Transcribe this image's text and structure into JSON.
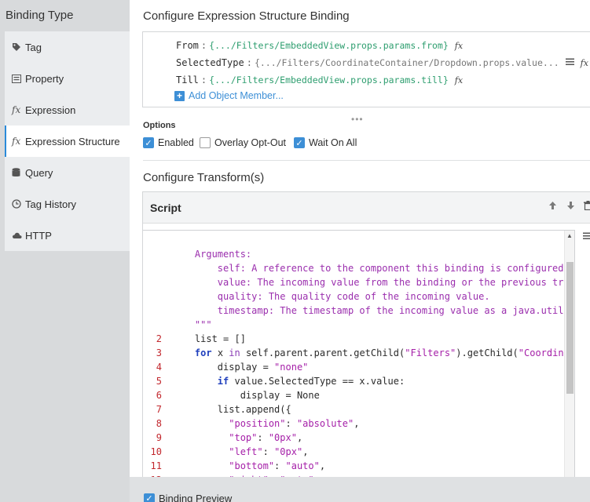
{
  "sidebar": {
    "title": "Binding Type",
    "items": [
      {
        "label": "Tag",
        "icon": "tag-icon"
      },
      {
        "label": "Property",
        "icon": "property-icon"
      },
      {
        "label": "Expression",
        "icon": "fx-icon"
      },
      {
        "label": "Expression Structure",
        "icon": "fx-icon",
        "active": true
      },
      {
        "label": "Query",
        "icon": "database-icon"
      },
      {
        "label": "Tag History",
        "icon": "clock-icon"
      },
      {
        "label": "HTTP",
        "icon": "cloud-icon"
      }
    ],
    "fx_glyph": "fx"
  },
  "structure": {
    "title": "Configure Expression Structure Binding",
    "rows": [
      {
        "key": "From",
        "value": "{.../Filters/EmbeddedView.props.params.from}"
      },
      {
        "key": "SelectedType",
        "value": "{.../Filters/CoordinateContainer/Dropdown.props.value..."
      },
      {
        "key": "Till",
        "value": "{.../Filters/EmbeddedView.props.params.till}"
      }
    ],
    "add_member_label": "Add Object Member...",
    "add_member_glyph": "+",
    "resize_glyph": "•••"
  },
  "options": {
    "label": "Options",
    "enabled": {
      "label": "Enabled",
      "checked": true
    },
    "overlay_opt_out": {
      "label": "Overlay Opt-Out",
      "checked": false
    },
    "wait_on_all": {
      "label": "Wait On All",
      "checked": true
    }
  },
  "transforms": {
    "title": "Configure Transform(s)",
    "script_title": "Script",
    "code_lines": [
      {
        "n": "",
        "tokens": [
          {
            "t": "    Arguments:",
            "c": "doc"
          }
        ]
      },
      {
        "n": "",
        "tokens": [
          {
            "t": "        self: A reference to the component this binding is configured on.",
            "c": "doc"
          }
        ]
      },
      {
        "n": "",
        "tokens": [
          {
            "t": "        value: The incoming value from the binding or the previous transform.",
            "c": "doc"
          }
        ]
      },
      {
        "n": "",
        "tokens": [
          {
            "t": "        quality: The quality code of the incoming value.",
            "c": "doc"
          }
        ]
      },
      {
        "n": "",
        "tokens": [
          {
            "t": "        timestamp: The timestamp of the incoming value as a java.util.Date",
            "c": "doc"
          }
        ]
      },
      {
        "n": "",
        "tokens": [
          {
            "t": "    \"\"\"",
            "c": "doc"
          }
        ]
      },
      {
        "n": "2",
        "tokens": [
          {
            "t": "    list = []",
            "c": "id"
          }
        ]
      },
      {
        "n": "3",
        "tokens": [
          {
            "t": "    ",
            "c": "id"
          },
          {
            "t": "for",
            "c": "kw"
          },
          {
            "t": " x ",
            "c": "id"
          },
          {
            "t": "in",
            "c": "in"
          },
          {
            "t": " self.parent.parent.getChild(",
            "c": "id"
          },
          {
            "t": "\"Filters\"",
            "c": "str"
          },
          {
            "t": ").getChild(",
            "c": "id"
          },
          {
            "t": "\"CoordinateContainer\"",
            "c": "str"
          }
        ]
      },
      {
        "n": "4",
        "tokens": [
          {
            "t": "        display = ",
            "c": "id"
          },
          {
            "t": "\"none\"",
            "c": "str"
          }
        ]
      },
      {
        "n": "5",
        "tokens": [
          {
            "t": "        ",
            "c": "id"
          },
          {
            "t": "if",
            "c": "kw"
          },
          {
            "t": " value.SelectedType == x.value:",
            "c": "id"
          }
        ]
      },
      {
        "n": "6",
        "tokens": [
          {
            "t": "            display = None",
            "c": "id"
          }
        ]
      },
      {
        "n": "7",
        "tokens": [
          {
            "t": "        list.append({",
            "c": "id"
          }
        ]
      },
      {
        "n": "8",
        "tokens": [
          {
            "t": "          ",
            "c": "id"
          },
          {
            "t": "\"position\"",
            "c": "str"
          },
          {
            "t": ": ",
            "c": "id"
          },
          {
            "t": "\"absolute\"",
            "c": "str"
          },
          {
            "t": ",",
            "c": "id"
          }
        ]
      },
      {
        "n": "9",
        "tokens": [
          {
            "t": "          ",
            "c": "id"
          },
          {
            "t": "\"top\"",
            "c": "str"
          },
          {
            "t": ": ",
            "c": "id"
          },
          {
            "t": "\"0px\"",
            "c": "str"
          },
          {
            "t": ",",
            "c": "id"
          }
        ]
      },
      {
        "n": "10",
        "tokens": [
          {
            "t": "          ",
            "c": "id"
          },
          {
            "t": "\"left\"",
            "c": "str"
          },
          {
            "t": ": ",
            "c": "id"
          },
          {
            "t": "\"0px\"",
            "c": "str"
          },
          {
            "t": ",",
            "c": "id"
          }
        ]
      },
      {
        "n": "11",
        "tokens": [
          {
            "t": "          ",
            "c": "id"
          },
          {
            "t": "\"bottom\"",
            "c": "str"
          },
          {
            "t": ": ",
            "c": "id"
          },
          {
            "t": "\"auto\"",
            "c": "str"
          },
          {
            "t": ",",
            "c": "id"
          }
        ]
      },
      {
        "n": "12",
        "tokens": [
          {
            "t": "          ",
            "c": "id"
          },
          {
            "t": "\"right\"",
            "c": "str"
          },
          {
            "t": ": ",
            "c": "id"
          },
          {
            "t": "\"auto\"",
            "c": "str"
          },
          {
            "t": ",",
            "c": "id"
          }
        ]
      }
    ]
  },
  "footer": {
    "preview": {
      "label": "Binding Preview",
      "checked": true
    }
  },
  "colors": {
    "accent": "#3d8fd6",
    "doc_string": "#9b2fae",
    "keyword": "#1f3fbd",
    "line_number": "#c2272d",
    "binding_value": "#2e9e6f"
  }
}
